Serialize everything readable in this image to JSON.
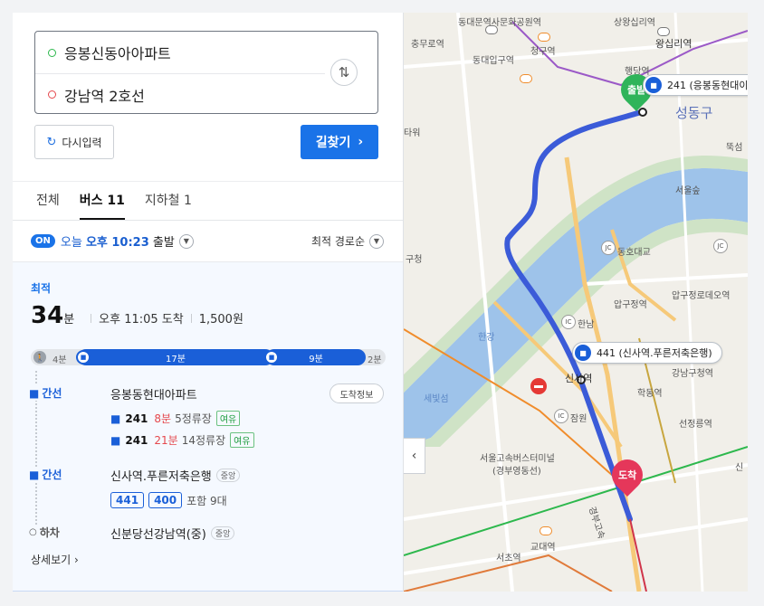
{
  "search": {
    "origin": "응봉신동아아파트",
    "destination": "강남역 2호선",
    "reset_label": "다시입력",
    "go_label": "길찾기"
  },
  "tabs": [
    {
      "label": "전체"
    },
    {
      "label": "버스 11"
    },
    {
      "label": "지하철 1"
    }
  ],
  "depart": {
    "badge": "ON",
    "day": "오늘",
    "time": "오후 10:23",
    "suffix": "출발",
    "sort_label": "최적 경로순"
  },
  "route": {
    "label": "최적",
    "total_minutes": "34",
    "total_unit": "분",
    "arrival": "오후 11:05 도착",
    "fare": "1,500원",
    "timeline": {
      "walk_start": "4분",
      "bus1": "17분",
      "bus2": "9분",
      "walk_end": "2분"
    },
    "steps": {
      "s1": {
        "type": "간선",
        "stop": "응봉동현대아파트",
        "arrival_btn": "도착정보",
        "buses": [
          {
            "no": "241",
            "eta": "8분",
            "stops": "5정류장",
            "seat": "여유"
          },
          {
            "no": "241",
            "eta": "21분",
            "stops": "14정류장",
            "seat": "여유"
          }
        ]
      },
      "s2": {
        "type": "간선",
        "stop": "신사역.푸른저축은행",
        "tag": "중앙",
        "chips": [
          "441",
          "400"
        ],
        "extra": "포함 9대"
      },
      "s3": {
        "type": "하차",
        "stop": "신분당선강남역(중)",
        "tag": "중앙"
      }
    },
    "more_label": "상세보기"
  },
  "map": {
    "start_label": "출발",
    "end_label": "도착",
    "bus1_label": "241 (응봉동현대이",
    "bus2_label": "441 (신사역.푸른저축은행)",
    "places": {
      "p1": "동대문역사문화공원역",
      "p2": "상왕십리역",
      "p3": "충무로역",
      "p4": "청구역",
      "p5": "왕십리역",
      "p6": "동대입구역",
      "p7": "행당역",
      "p8": "타워",
      "p9": "성동구",
      "p10": "뚝섬",
      "p11": "서울숲",
      "p12": "구청",
      "p13": "동호대교",
      "p14": "압구정역",
      "p15": "압구정로데오역",
      "p16": "한강",
      "p17": "한남",
      "p18": "세빛섬",
      "p19": "신사역",
      "p20": "학동역",
      "p21": "잠원",
      "p22": "서울고속버스터미널",
      "p23": "(경부영동선)",
      "p24": "선정릉역",
      "p25": "교대역",
      "p26": "서초역",
      "p27": "경부고속",
      "p28": "강남구청역",
      "p29": "신"
    }
  }
}
